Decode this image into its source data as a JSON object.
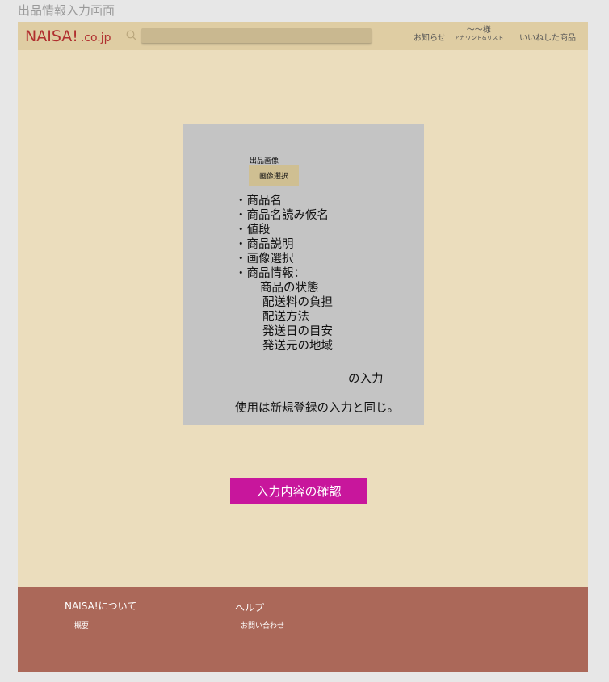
{
  "page_title": "出品情報入力画面",
  "header": {
    "logo_main": "NAISA!",
    "logo_sub": ".co.jp",
    "search_placeholder": "",
    "news_label": "お知らせ",
    "account_name": "〜〜様",
    "account_sub": "アカウント&リスト",
    "liked_label": "いいねした商品"
  },
  "form_card": {
    "image_label": "出品画像",
    "image_button": "画像選択",
    "items": [
      "・商品名",
      "・商品名読み仮名",
      "・値段",
      "・商品説明",
      "・画像選択",
      "・商品情報："
    ],
    "sub_items": [
      "商品の状態",
      "配送料の負担",
      "配送方法",
      "発送日の目安",
      "発送元の地域"
    ],
    "input_note": "の入力",
    "usage_note": "使用は新規登録の入力と同じ。"
  },
  "confirm_button": "入力内容の確認",
  "footer": {
    "about_title": "NAISA!について",
    "overview_link": "概要",
    "help_title": "ヘルプ",
    "contact_link": "お問い合わせ"
  },
  "colors": {
    "header_bg": "#dfcda3",
    "body_bg": "#ebddbd",
    "logo": "#b02f2f",
    "card_bg": "#c4c4c4",
    "confirm_button_bg": "#c8169c",
    "footer_bg": "#ab6859"
  },
  "icons": {
    "search": "search-icon"
  }
}
